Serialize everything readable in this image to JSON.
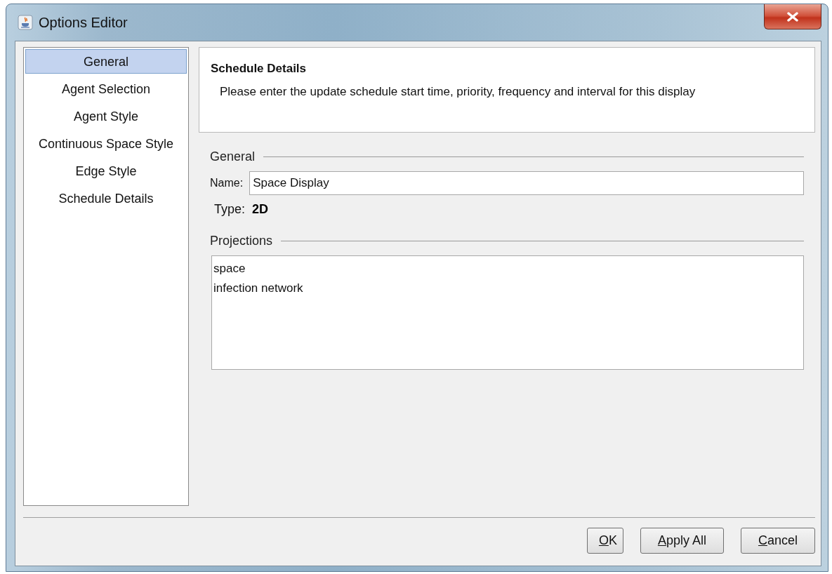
{
  "window": {
    "title": "Options Editor"
  },
  "sidebar": {
    "items": [
      {
        "label": "General",
        "selected": true
      },
      {
        "label": "Agent Selection",
        "selected": false
      },
      {
        "label": "Agent Style",
        "selected": false
      },
      {
        "label": "Continuous Space Style",
        "selected": false
      },
      {
        "label": "Edge Style",
        "selected": false
      },
      {
        "label": "Schedule Details",
        "selected": false
      }
    ]
  },
  "header": {
    "title": "Schedule Details",
    "description": "Please enter the update schedule start time, priority, frequency and interval for this display"
  },
  "general": {
    "heading": "General",
    "name_label": "Name:",
    "name_value": "Space Display",
    "type_label": "Type:",
    "type_value": "2D"
  },
  "projections": {
    "heading": "Projections",
    "items": [
      "space",
      "infection network"
    ]
  },
  "buttons": [
    {
      "label": "OK",
      "mnemonic_underlined": true
    },
    {
      "label": "Apply All",
      "mnemonic_underlined": true
    },
    {
      "label": "Cancel",
      "mnemonic_underlined": true
    }
  ]
}
